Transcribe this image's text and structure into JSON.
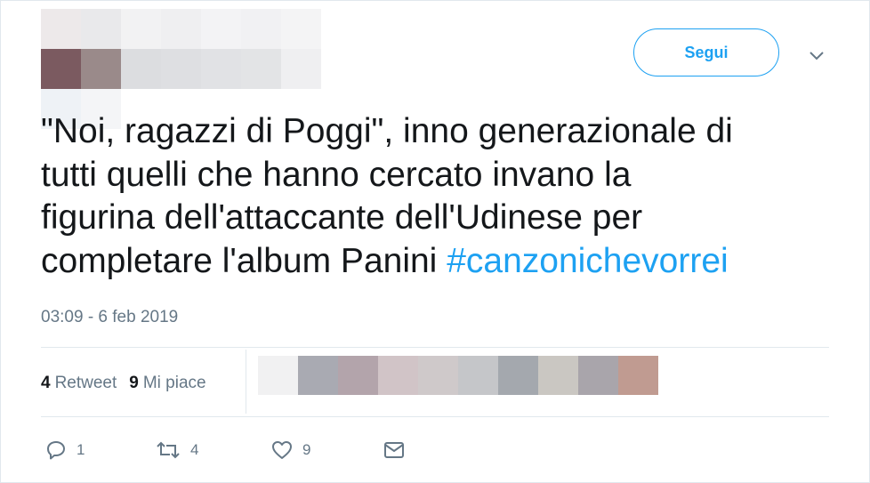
{
  "author": {
    "avatar_colors": [
      "#ede9ea",
      "#e9e9eb",
      "#7b5a60",
      "#9a8a8a",
      "#eef2f6",
      "#f4f5f7"
    ],
    "name_colors": [
      "#f2f2f3",
      "#efeff1",
      "#f3f3f5",
      "#f1f1f3",
      "#f4f4f5",
      "#dcdde0",
      "#dedfe2",
      "#e1e2e5",
      "#e3e4e6",
      "#efeff1"
    ]
  },
  "follow_button": {
    "label": "Segui",
    "color": "#1da1f2"
  },
  "menu": {
    "icon": "chevron-down-icon"
  },
  "tweet": {
    "line1": "\"Noi, ragazzi di Poggi\", inno generazionale di",
    "line2": "tutti quelli che hanno cercato invano la",
    "line3": "figurina dell'attaccante dell'Udinese per",
    "line4_prefix": "completare l'album Panini ",
    "hashtag": "#canzonichevorrei"
  },
  "timestamp": "03:09 - 6 feb 2019",
  "stats": {
    "retweets_count": "4",
    "retweets_label": "Retweet",
    "likes_count": "9",
    "likes_label": "Mi piace"
  },
  "likers_colors": [
    "#f1f1f2",
    "#a9aab2",
    "#b3a4ab",
    "#d1c4c7",
    "#cfc9ca",
    "#c5c6c9",
    "#a4a8ae",
    "#cac7c2",
    "#a9a5ab",
    "#c09b91"
  ],
  "actions": {
    "reply_count": "1",
    "retweet_count": "4",
    "like_count": "9",
    "reply_icon": "reply-icon",
    "retweet_icon": "retweet-icon",
    "like_icon": "heart-icon",
    "dm_icon": "mail-icon"
  }
}
